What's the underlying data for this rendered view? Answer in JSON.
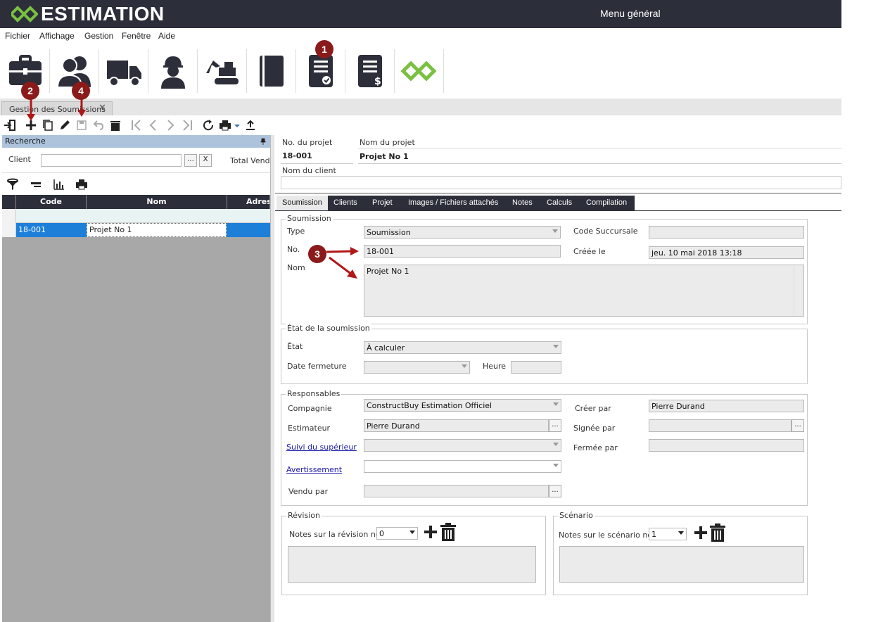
{
  "app": {
    "name": "ESTIMATION",
    "window_title": "Menu général",
    "brand_color": "#7ac142"
  },
  "menu": [
    "Fichier",
    "Affichage",
    "Gestion",
    "Fenêtre",
    "Aide"
  ],
  "ribbon": [
    {
      "icon": "briefcase-icon"
    },
    {
      "icon": "users-icon"
    },
    {
      "icon": "truck-icon"
    },
    {
      "icon": "worker-icon"
    },
    {
      "icon": "excavator-icon"
    },
    {
      "icon": "book-icon"
    },
    {
      "icon": "document-check-icon"
    },
    {
      "icon": "invoice-icon"
    },
    {
      "icon": "logo-icon"
    }
  ],
  "doc_tab": {
    "label": "Gestion des Soumissions",
    "close": "✕"
  },
  "badges": [
    "1",
    "2",
    "3",
    "4"
  ],
  "search": {
    "title": "Recherche",
    "client_label": "Client",
    "client_value": "",
    "ellipsis": "...",
    "clear": "X",
    "total_label": "Total Venda"
  },
  "grid": {
    "columns": [
      "Code",
      "Nom",
      "Adres"
    ],
    "rows": [
      {
        "code": "18-001",
        "nom": "Projet No 1",
        "adresse": ""
      }
    ]
  },
  "project": {
    "no_label": "No. du projet",
    "no_value": "18-001",
    "name_label": "Nom du projet",
    "name_value": "Projet No 1",
    "client_label": "Nom du client",
    "client_value": ""
  },
  "tabs": [
    "Soumission",
    "Clients",
    "Projet",
    "Images / Fichiers attachés",
    "Notes",
    "Calculs",
    "Compilation"
  ],
  "soumission": {
    "group": "Soumission",
    "type_label": "Type",
    "type_value": "Soumission",
    "no_label": "No.",
    "no_value": "18-001",
    "nom_label": "Nom",
    "nom_value": "Projet No 1",
    "succursale_label": "Code Succursale",
    "succursale_value": "",
    "creee_label": "Créée le",
    "creee_value": "jeu. 10 mai 2018 13:18"
  },
  "etat": {
    "group": "État de la soumission",
    "etat_label": "État",
    "etat_value": "À calculer",
    "date_label": "Date fermeture",
    "date_value": "",
    "heure_label": "Heure",
    "heure_value": ""
  },
  "responsables": {
    "group": "Responsables",
    "compagnie_label": "Compagnie",
    "compagnie_value": "ConstructBuy Estimation Officiel",
    "estimateur_label": "Estimateur",
    "estimateur_value": "Pierre Durand",
    "suivi_label": "Suivi du supérieur",
    "avertissement_label": "Avertissement",
    "vendu_label": "Vendu par",
    "creer_label": "Créer par",
    "creer_value": "Pierre Durand",
    "signee_label": "Signée par",
    "signee_value": "",
    "fermee_label": "Fermée par",
    "fermee_value": ""
  },
  "revision": {
    "group": "Révision",
    "notes_label": "Notes sur la révision no.",
    "value": "0"
  },
  "scenario": {
    "group": "Scénario",
    "notes_label": "Notes sur le scénario no.",
    "value": "1"
  }
}
